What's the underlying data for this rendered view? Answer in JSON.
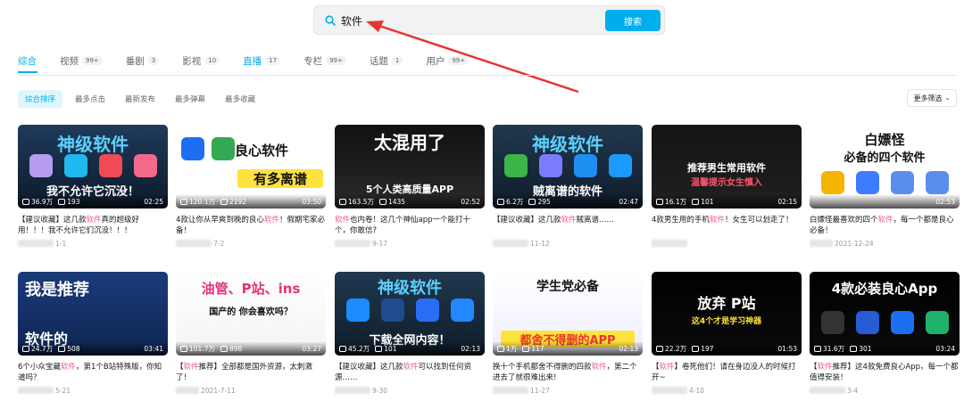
{
  "search": {
    "value": "软件",
    "button_label": "搜索"
  },
  "tabs": [
    {
      "label": "综合",
      "badge": ""
    },
    {
      "label": "视频",
      "badge": "99+"
    },
    {
      "label": "番剧",
      "badge": "3"
    },
    {
      "label": "影视",
      "badge": "10"
    },
    {
      "label": "直播",
      "badge": "17"
    },
    {
      "label": "专栏",
      "badge": "99+"
    },
    {
      "label": "话题",
      "badge": "1"
    },
    {
      "label": "用户",
      "badge": "99+"
    }
  ],
  "filters": [
    "综合排序",
    "最多点击",
    "最新发布",
    "最多弹幕",
    "最多收藏"
  ],
  "more_filter": "更多筛选",
  "cards": [
    {
      "thumb_title": "神级软件",
      "thumb_sub": "我不允许它沉没！",
      "views": "36.9万",
      "danmaku": "193",
      "duration": "02:25",
      "title_pre": "【建议收藏】这几款",
      "title_hl": "软件",
      "title_post": "真的超级好用！！！我不允许它们沉没！！！",
      "date": "1-1"
    },
    {
      "thumb_title": "良心软件",
      "thumb_sub": "有多离谱",
      "views": "120.1万",
      "danmaku": "2192",
      "duration": "03:50",
      "title_pre": "4款让你从早爽到晚的良心",
      "title_hl": "软件",
      "title_post": "！假期宅家必备！",
      "date": "7-2"
    },
    {
      "thumb_title": "太混用了",
      "thumb_sub": "5个人类高质量APP",
      "views": "163.5万",
      "danmaku": "1435",
      "duration": "02:52",
      "title_pre": "",
      "title_hl": "软件",
      "title_post": "也内卷！这几个神仙app一个能打十个，你敢信?",
      "date": "9-17"
    },
    {
      "thumb_title": "神级软件",
      "thumb_sub": "贼离谱的软件",
      "views": "6.2万",
      "danmaku": "295",
      "duration": "02:47",
      "title_pre": "【建议收藏】这几款",
      "title_hl": "软件",
      "title_post": "贼离谱……",
      "date": "11-12"
    },
    {
      "thumb_title": "推荐男生常用软件",
      "thumb_sub": "温馨提示女生慎入",
      "views": "16.1万",
      "danmaku": "101",
      "duration": "02:15",
      "title_pre": "4款男生用的手机",
      "title_hl": "软件",
      "title_post": "！女生可以划走了！",
      "date": ""
    },
    {
      "thumb_title": "白嫖怪",
      "thumb_sub": "必备的四个软件",
      "views": "",
      "danmaku": "",
      "duration": "02:53",
      "title_pre": "白嫖怪最喜欢的四个",
      "title_hl": "软件",
      "title_post": "，每一个都是良心必备！",
      "date": "2021-12-24"
    },
    {
      "thumb_title": "我是推荐",
      "thumb_sub": "软件的",
      "views": "24.7万",
      "danmaku": "508",
      "duration": "03:41",
      "title_pre": "6个小众宝藏",
      "title_hl": "软件",
      "title_post": "，第1个B站特殊版，你知道吗？",
      "date": "5-21"
    },
    {
      "thumb_title": "油管、P站、ins",
      "thumb_sub": "国产的 你会喜欢吗？",
      "views": "101.7万",
      "danmaku": "898",
      "duration": "03:27",
      "title_pre": "【",
      "title_hl": "软件",
      "title_post": "推荐】全部都是国外资源，太刺激了！",
      "date": "2021-7-11"
    },
    {
      "thumb_title": "神级软件",
      "thumb_sub": "下载全网内容！",
      "views": "45.2万",
      "danmaku": "101",
      "duration": "02:13",
      "title_pre": "【建议收藏】这几款",
      "title_hl": "软件",
      "title_post": "可以找到任何资源……",
      "date": "9-30"
    },
    {
      "thumb_title": "学生党必备",
      "thumb_sub": "都舍不得删的APP",
      "views": "1万",
      "danmaku": "117",
      "duration": "02:13",
      "title_pre": "换十个手机都舍不得删的四款",
      "title_hl": "软件",
      "title_post": "，第二个进去了就很难出来!",
      "date": "11-27"
    },
    {
      "thumb_title": "放弃 P站",
      "thumb_sub": "这4个才是学习神器",
      "views": "22.2万",
      "danmaku": "197",
      "duration": "01:53",
      "title_pre": "【",
      "title_hl": "软件",
      "title_post": "】卷死他们！请在身边没人的时候打开~",
      "date": "4-10"
    },
    {
      "thumb_title": "4款必装良心App",
      "thumb_sub": "",
      "views": "31.6万",
      "danmaku": "301",
      "duration": "03:24",
      "title_pre": "【",
      "title_hl": "软件",
      "title_post": "推荐】这4款免费良心App，每一个都值得安装！",
      "date": "3-4"
    }
  ],
  "colors": {
    "accent": "#00aeec",
    "highlight": "#f25d8e",
    "arrow": "#e8362d"
  }
}
